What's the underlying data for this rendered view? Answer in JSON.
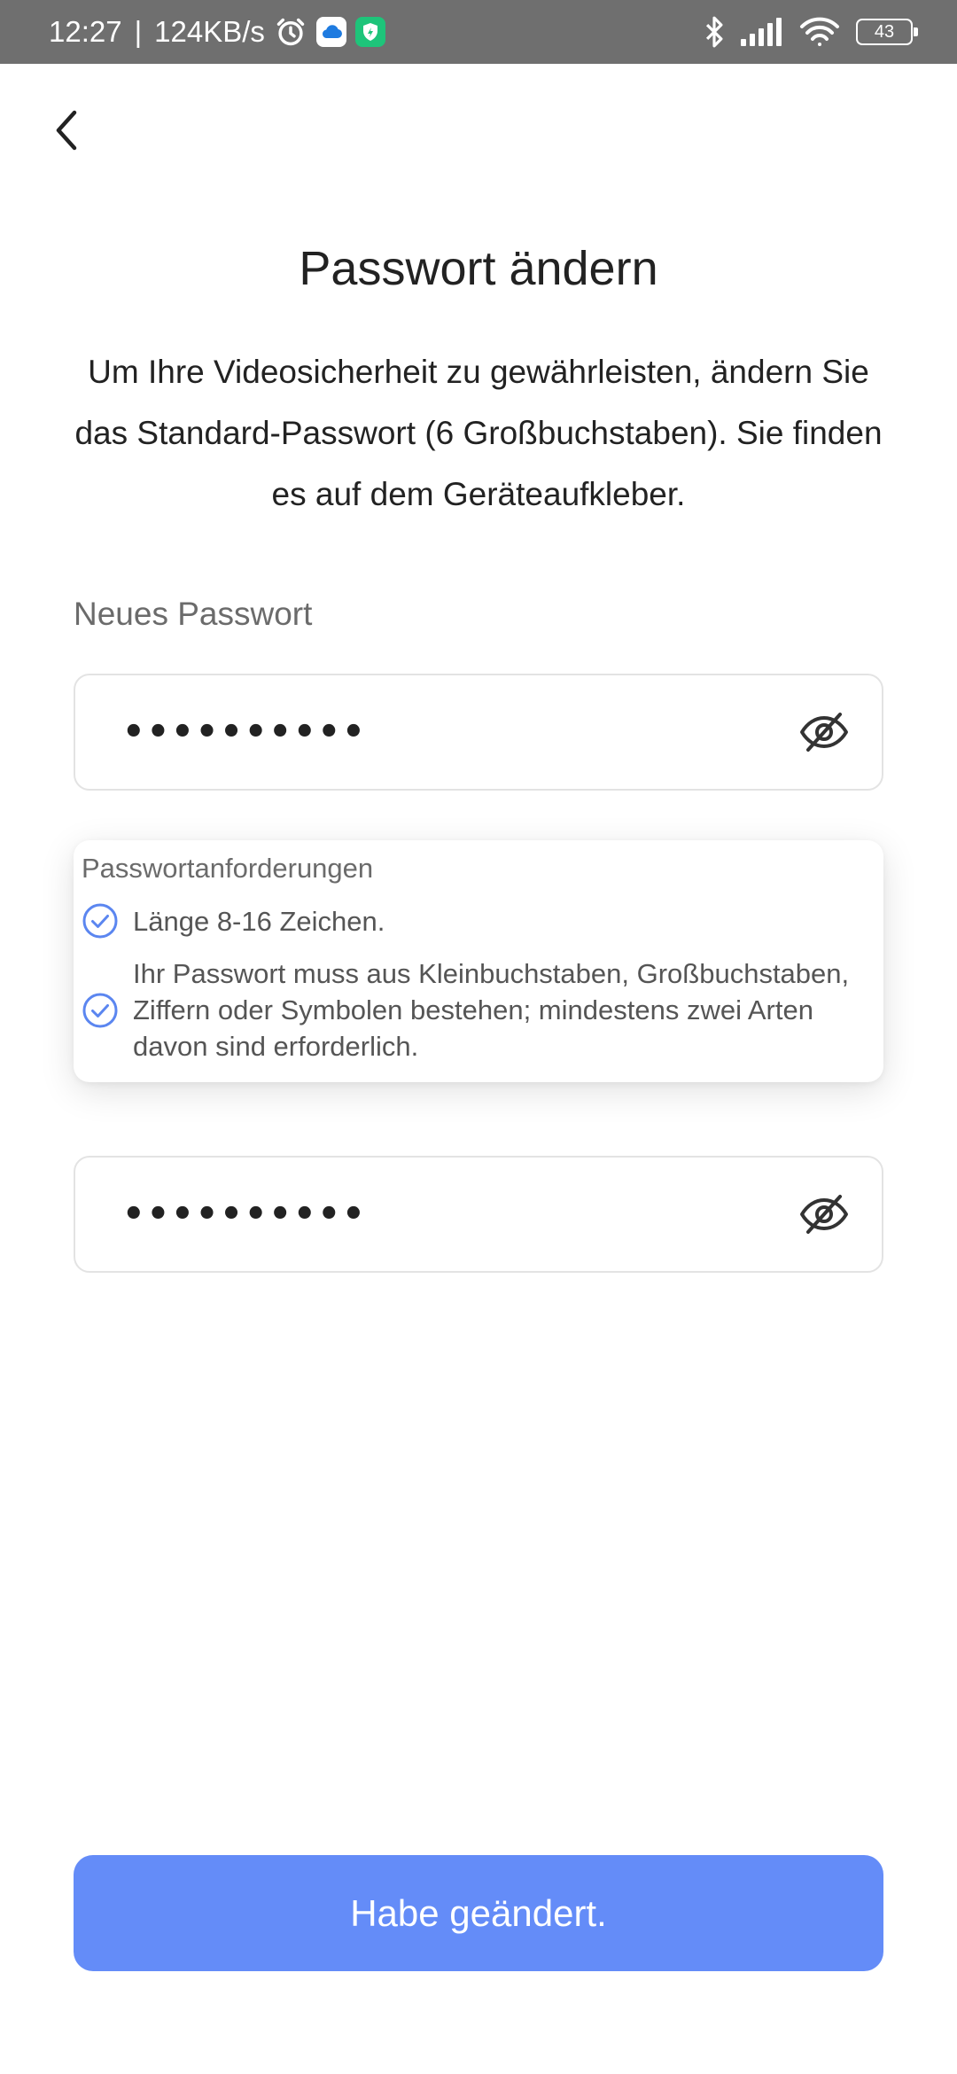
{
  "status_bar": {
    "time": "12:27",
    "separator": "|",
    "network_speed": "124KB/s",
    "battery_level": "43",
    "icons": [
      "alarm-icon",
      "cloud-app-icon",
      "shield-app-icon",
      "bluetooth-icon",
      "signal-icon",
      "wifi-icon",
      "battery-icon"
    ]
  },
  "header": {
    "back_icon": "chevron-left-icon",
    "title": "Passwort ändern"
  },
  "description": "Um Ihre Videosicherheit zu gewährleisten, ändern Sie das Standard-Passwort (6 Großbuchstaben). Sie finden es auf dem Geräteaufkleber.",
  "new_password": {
    "label": "Neues Passwort",
    "value": "••••••••••",
    "toggle_icon": "eye-off-icon"
  },
  "requirements": {
    "title": "Passwortanforderungen",
    "items": [
      {
        "text": "Länge 8-16 Zeichen.",
        "icon": "check-circle-icon"
      },
      {
        "text": "Ihr Passwort muss aus Kleinbuchstaben, Großbuchstaben, Ziffern oder Symbolen bestehen; mindestens zwei Arten davon sind erforderlich.",
        "icon": "check-circle-icon"
      }
    ]
  },
  "confirm_password": {
    "value": "••••••••••",
    "toggle_icon": "eye-off-icon"
  },
  "submit_button": {
    "label": "Habe geändert."
  },
  "colors": {
    "accent": "#648cf8",
    "check": "#5b86f0",
    "status_bar": "#6f6f6f",
    "text_primary": "#222222",
    "text_secondary": "#6b6b6b",
    "border": "#e3e3e3"
  }
}
